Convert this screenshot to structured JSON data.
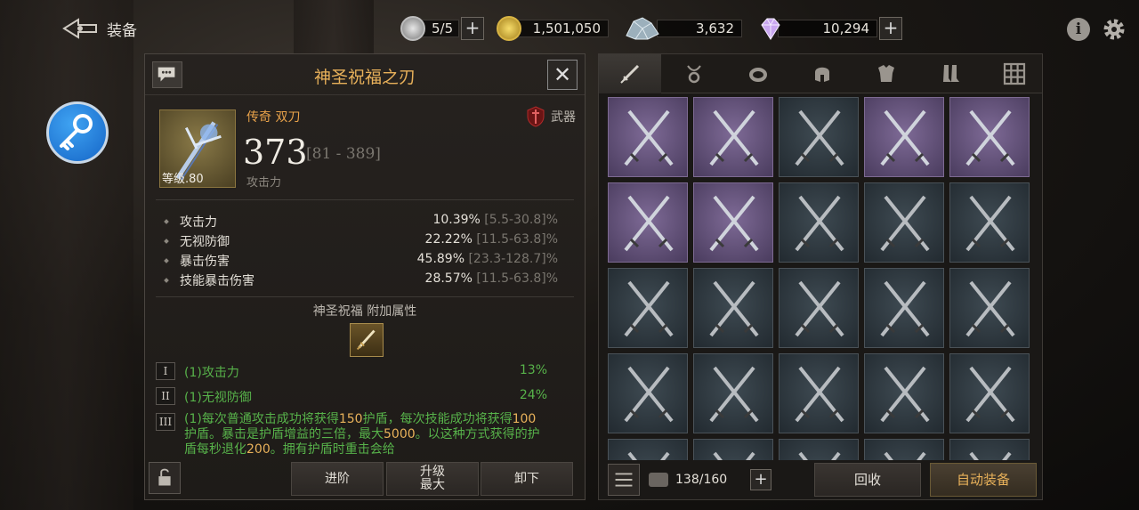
{
  "header": {
    "title": "装备"
  },
  "currencies": [
    {
      "name": "stamina",
      "value": "5/5",
      "icon": "silver-coin-icon",
      "has_plus": true
    },
    {
      "name": "gold",
      "value": "1,501,050",
      "icon": "gold-coin-icon",
      "has_plus": false
    },
    {
      "name": "crystal",
      "value": "3,632",
      "icon": "crystal-icon",
      "has_plus": false
    },
    {
      "name": "diamond",
      "value": "10,294",
      "icon": "diamond-icon",
      "has_plus": true
    }
  ],
  "item": {
    "name": "神圣祝福之刃",
    "rarity_type": "传奇 双刀",
    "category": "武器",
    "level": "等级.80",
    "attack": "373",
    "attack_range": "[81 - 389]",
    "attack_label": "攻击力",
    "stats": [
      {
        "name": "攻击力",
        "value": "10.39%",
        "range": "[5.5-30.8]%"
      },
      {
        "name": "无视防御",
        "value": "22.22%",
        "range": "[11.5-63.8]%"
      },
      {
        "name": "暴击伤害",
        "value": "45.89%",
        "range": "[23.3-128.7]%"
      },
      {
        "name": "技能暴击伤害",
        "value": "28.57%",
        "range": "[11.5-63.8]%"
      }
    ],
    "blessing_title": "神圣祝福 附加属性",
    "blessings": [
      {
        "tier": "I",
        "name": "(1)攻击力",
        "pct": "13%"
      },
      {
        "tier": "II",
        "name": "(1)无视防御",
        "pct": "24%"
      },
      {
        "tier": "III"
      }
    ],
    "blessing_desc": {
      "p1": "(1)每次普通攻击成功将获得",
      "n1": "150",
      "p2": "护盾，每次技能成功将获得",
      "n2": "100",
      "p3": "护盾。暴击是护盾增益的三倍，最大",
      "n3": "5000",
      "p4": "。以这种方式获得的护盾每秒退化",
      "n4": "200",
      "p5": "。拥有护盾时重击会给"
    },
    "buttons": {
      "advance": "进阶",
      "upgrade_line1": "升级",
      "upgrade_line2": "最大",
      "unequip": "卸下"
    }
  },
  "inventory": {
    "capacity": "138/160",
    "recycle_label": "回收",
    "auto_equip_label": "自动装备",
    "tabs": [
      "sword-icon",
      "amulet-icon",
      "ring-icon",
      "helmet-icon",
      "armor-icon",
      "boots-icon",
      "grid-icon"
    ],
    "slot_rarity": [
      "epic",
      "epic",
      "norm",
      "epic",
      "epic",
      "epic",
      "epic",
      "norm",
      "norm",
      "norm",
      "norm",
      "norm",
      "norm",
      "norm",
      "norm",
      "norm",
      "norm",
      "norm",
      "norm",
      "norm",
      "norm",
      "norm",
      "norm",
      "norm",
      "norm"
    ]
  },
  "colors": {
    "legendary": "#e8a24a",
    "title": "#e8b15a",
    "bonus": "#57b24a",
    "epic": "#7e6a96"
  }
}
